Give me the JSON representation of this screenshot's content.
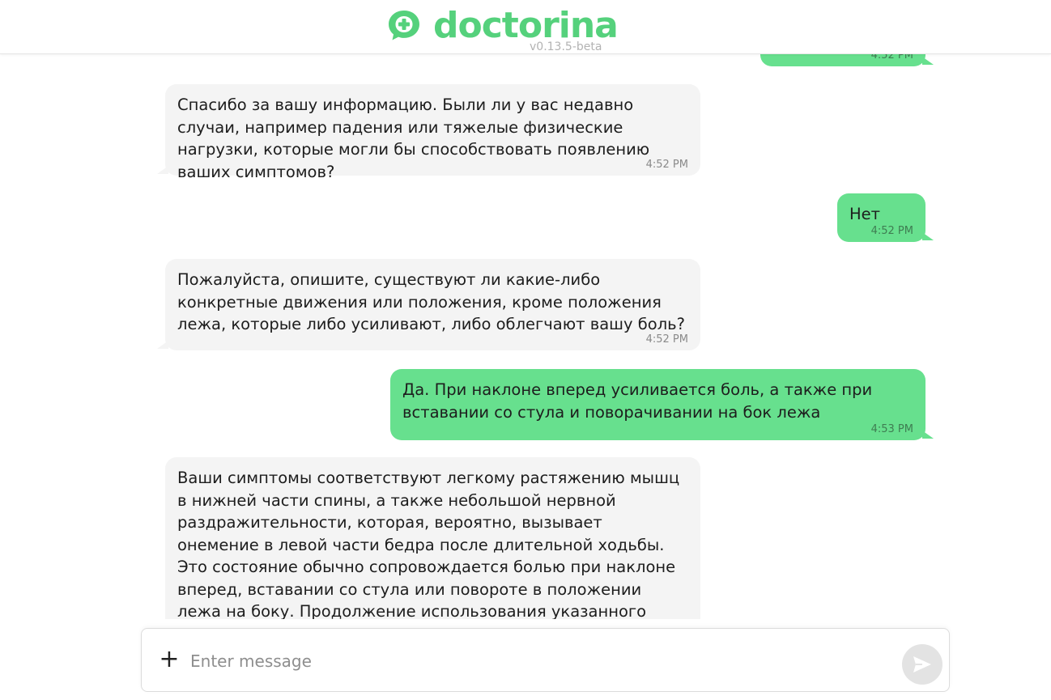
{
  "header": {
    "logo_text": "doctorina",
    "version": "v0.13.5-beta"
  },
  "messages": [
    {
      "from": "user",
      "text": "",
      "time": "4:52 PM"
    },
    {
      "from": "bot",
      "text": "Спасибо за вашу информацию. Были ли у вас недавно случаи, например падения или тяжелые физические нагрузки, которые могли бы способствовать появлению ваших симптомов?",
      "time": "4:52 PM"
    },
    {
      "from": "user",
      "text": "Нет",
      "time": "4:52 PM"
    },
    {
      "from": "bot",
      "text": "Пожалуйста, опишите, существуют ли какие-либо конкретные движения или положения, кроме положения лежа, которые либо усиливают, либо облегчают вашу боль?",
      "time": "4:52 PM"
    },
    {
      "from": "user",
      "text": "Да. При наклоне вперед усиливается боль, а также при вставании со стула и поворачивании на бок лежа",
      "time": "4:53 PM"
    },
    {
      "from": "bot",
      "text": "Ваши симптомы соответствуют легкому растяжению мышц в нижней части спины, а также небольшой нервной раздражительности, которая, вероятно, вызывает онемение в левой части бедра после длительной ходьбы. Это состояние обычно сопровождается болью при наклоне вперед, вставании со стула или повороте в положении лежа на боку. Продолжение использования указанного вами местного лечения, а также",
      "time": ""
    }
  ],
  "composer": {
    "placeholder": "Enter message",
    "value": ""
  },
  "colors": {
    "brand": "#55d17c",
    "user_bubble": "#67e08e",
    "bot_bubble": "#f4f4f4"
  },
  "icons": {
    "logo": "chat-plus-logo-icon",
    "attach": "plus-icon",
    "send": "send-icon"
  }
}
